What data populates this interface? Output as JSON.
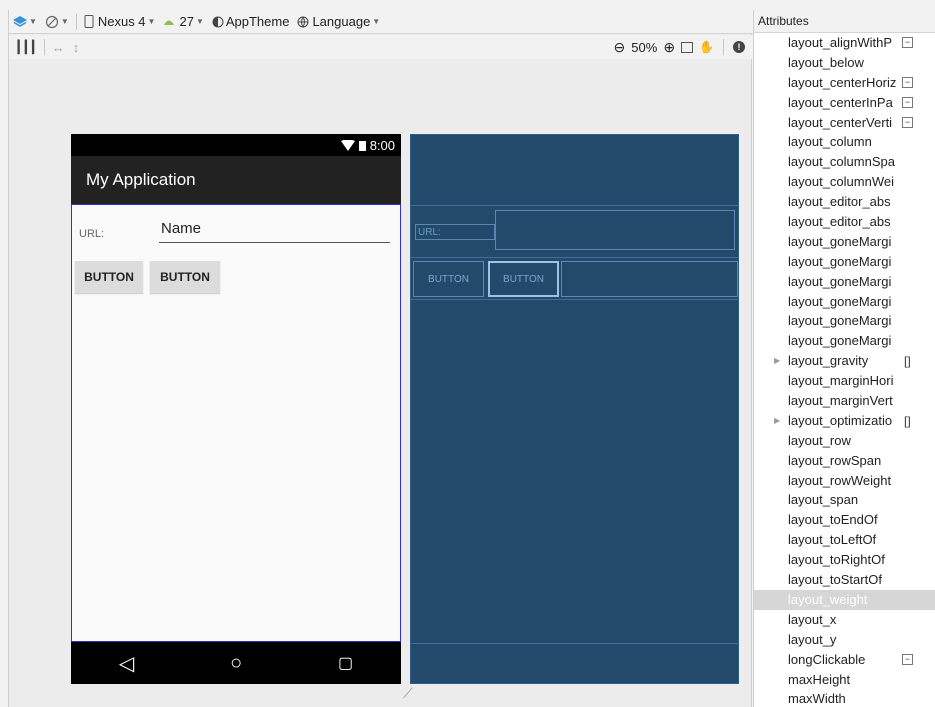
{
  "toolbar": {
    "device": "Nexus 4",
    "api": "27",
    "theme": "AppTheme",
    "language": "Language",
    "zoom": "50%"
  },
  "phone": {
    "time": "8:00",
    "app_title": "My Application",
    "url_label": "URL:",
    "name_value": "Name",
    "button1": "BUTTON",
    "button2": "BUTTON"
  },
  "blueprint": {
    "url_label": "URL:",
    "button1": "BUTTON",
    "button2": "BUTTON"
  },
  "attributes": {
    "header": "Attributes",
    "items": [
      {
        "label": "layout_alignWithP",
        "control": "flag"
      },
      {
        "label": "layout_below",
        "control": ""
      },
      {
        "label": "layout_centerHoriz",
        "control": "flag"
      },
      {
        "label": "layout_centerInPa",
        "control": "flag"
      },
      {
        "label": "layout_centerVerti",
        "control": "flag"
      },
      {
        "label": "layout_column",
        "control": ""
      },
      {
        "label": "layout_columnSpa",
        "control": ""
      },
      {
        "label": "layout_columnWei",
        "control": ""
      },
      {
        "label": "layout_editor_abs",
        "control": ""
      },
      {
        "label": "layout_editor_abs",
        "control": ""
      },
      {
        "label": "layout_goneMargi",
        "control": ""
      },
      {
        "label": "layout_goneMargi",
        "control": ""
      },
      {
        "label": "layout_goneMargi",
        "control": ""
      },
      {
        "label": "layout_goneMargi",
        "control": ""
      },
      {
        "label": "layout_goneMargi",
        "control": ""
      },
      {
        "label": "layout_goneMargi",
        "control": ""
      },
      {
        "label": "layout_gravity",
        "control": "bracket",
        "expandable": true
      },
      {
        "label": "layout_marginHori",
        "control": ""
      },
      {
        "label": "layout_marginVert",
        "control": ""
      },
      {
        "label": "layout_optimizatio",
        "control": "bracket",
        "expandable": true
      },
      {
        "label": "layout_row",
        "control": ""
      },
      {
        "label": "layout_rowSpan",
        "control": ""
      },
      {
        "label": "layout_rowWeight",
        "control": ""
      },
      {
        "label": "layout_span",
        "control": ""
      },
      {
        "label": "layout_toEndOf",
        "control": ""
      },
      {
        "label": "layout_toLeftOf",
        "control": ""
      },
      {
        "label": "layout_toRightOf",
        "control": ""
      },
      {
        "label": "layout_toStartOf",
        "control": ""
      },
      {
        "label": "layout_weight",
        "control": "",
        "selected": true
      },
      {
        "label": "layout_x",
        "control": ""
      },
      {
        "label": "layout_y",
        "control": ""
      },
      {
        "label": "longClickable",
        "control": "flag"
      },
      {
        "label": "maxHeight",
        "control": ""
      },
      {
        "label": "maxWidth",
        "control": ""
      }
    ]
  }
}
